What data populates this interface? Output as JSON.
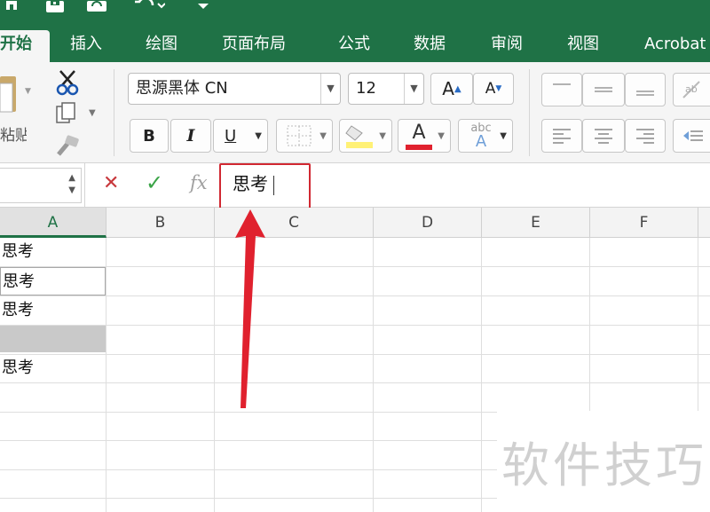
{
  "window": {
    "colors": {
      "accent": "#1f7246",
      "highlight": "#d12832",
      "arrow": "#e0212e"
    },
    "quick_access_icons": [
      "home-icon",
      "save-icon",
      "sync-icon",
      "undo-icon",
      "customize-icon"
    ]
  },
  "ribbon": {
    "tabs": [
      {
        "label": "开始",
        "active": true
      },
      {
        "label": "插入"
      },
      {
        "label": "绘图"
      },
      {
        "label": "页面布局"
      },
      {
        "label": "公式"
      },
      {
        "label": "数据"
      },
      {
        "label": "审阅"
      },
      {
        "label": "视图"
      },
      {
        "label": "Acrobat"
      }
    ],
    "clipboard": {
      "paste_label": "粘贴",
      "icons": [
        "paste-icon",
        "cut-icon",
        "copy-icon",
        "format-painter-icon"
      ]
    },
    "font": {
      "name": "思源黑体 CN",
      "size": "12",
      "increase_icon": "A",
      "decrease_icon": "A",
      "bold": "B",
      "italic": "I",
      "underline": "U",
      "font_color_letter": "A",
      "phonetic_label": "abc",
      "phonetic_letter": "A",
      "font_color": "#e0212e",
      "fill_color": "#fff176"
    }
  },
  "formula_bar": {
    "cancel_icon": "✕",
    "enter_icon": "✓",
    "fx_label": "fx",
    "value": "思考"
  },
  "grid": {
    "columns": [
      "A",
      "B",
      "C",
      "D",
      "E",
      "F"
    ],
    "active_column": "A",
    "column_a_cells": [
      "思考",
      "思考",
      "思考",
      "",
      "思考"
    ]
  },
  "watermark": "软件技巧"
}
